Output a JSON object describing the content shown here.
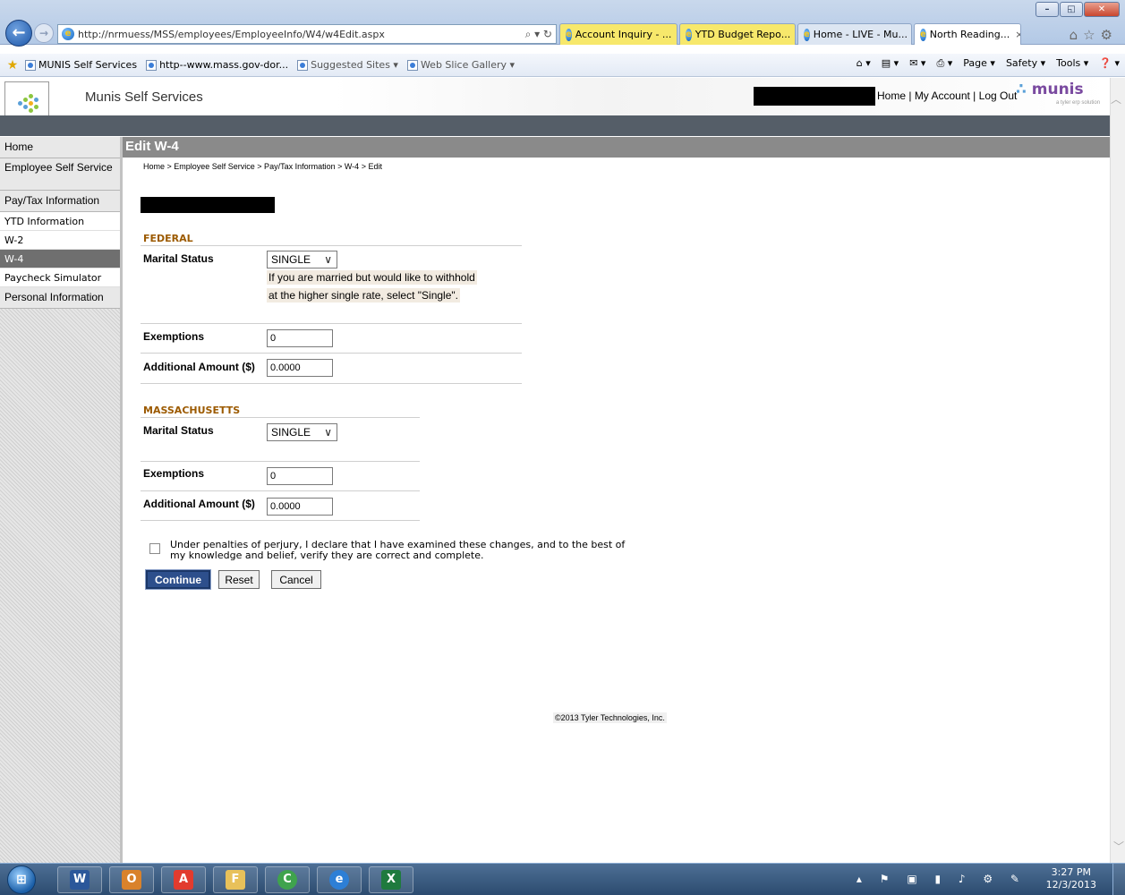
{
  "browser": {
    "url": "http://nrmuess/MSS/employees/EmployeeInfo/W4/w4Edit.aspx",
    "address_icons": "⌕ ▾ ↻",
    "tabs": [
      {
        "title": "Account Inquiry - ...",
        "style": "yellow"
      },
      {
        "title": "YTD Budget Repo...",
        "style": "yellow"
      },
      {
        "title": "Home - LIVE - Mu...",
        "style": "gray"
      },
      {
        "title": "North Reading...",
        "style": "active"
      }
    ],
    "tab_close": "×",
    "favorites": [
      {
        "label": "MUNIS Self Services"
      },
      {
        "label": "http--www.mass.gov-dor..."
      },
      {
        "label": "Suggested Sites ▾"
      },
      {
        "label": "Web Slice Gallery ▾"
      }
    ],
    "commands": [
      "⌂ ▾",
      "▤ ▾",
      "✉ ▾",
      "⎙ ▾",
      "Page ▾",
      "Safety ▾",
      "Tools ▾",
      "❓ ▾"
    ],
    "window_buttons": [
      "–",
      "◱",
      "✕"
    ]
  },
  "app": {
    "title": "Munis Self Services",
    "links": {
      "home": "Home",
      "sep1": " | ",
      "account": "My Account",
      "sep2": " | ",
      "logout": "Log Out"
    },
    "brand": "munis",
    "brand_sub": "a tyler erp solution",
    "page_title": "Edit W-4",
    "breadcrumb": "Home > Employee Self Service > Pay/Tax Information > W-4 > Edit"
  },
  "sidebar": {
    "items": [
      {
        "label": "Home"
      },
      {
        "label": "Employee Self Service"
      },
      {
        "label": "Pay/Tax Information"
      }
    ],
    "subitems": [
      {
        "label": "YTD Information"
      },
      {
        "label": "W-2"
      },
      {
        "label": "W-4"
      },
      {
        "label": "Paycheck Simulator"
      }
    ],
    "personal": "Personal Information"
  },
  "form": {
    "federal": {
      "heading": "FEDERAL",
      "marital_label": "Marital Status",
      "marital_value": "SINGLE",
      "hint_line1": "If you are married but would like to withhold",
      "hint_line2": "at the higher single rate, select \"Single\".",
      "exemptions_label": "Exemptions",
      "exemptions_value": "0",
      "additional_label": "Additional Amount ($)",
      "additional_value": "0.0000"
    },
    "state": {
      "heading": "MASSACHUSETTS",
      "marital_label": "Marital Status",
      "marital_value": "SINGLE",
      "exemptions_label": "Exemptions",
      "exemptions_value": "0",
      "additional_label": "Additional Amount ($)",
      "additional_value": "0.0000"
    },
    "perjury_text": "Under penalties of perjury, I declare that I have examined these changes, and to the best of my knowledge and belief, verify they are correct and complete.",
    "perjury_checked": false,
    "buttons": {
      "continue": "Continue",
      "reset": "Reset",
      "cancel": "Cancel"
    }
  },
  "footer": {
    "copyright": "©2013 Tyler Technologies, Inc."
  },
  "taskbar": {
    "apps": [
      {
        "name": "W",
        "color": "#2b579a"
      },
      {
        "name": "O",
        "color": "#d9822b"
      },
      {
        "name": "A",
        "color": "#e23b2e"
      },
      {
        "name": "F",
        "color": "#e8c15a"
      },
      {
        "name": "C",
        "color": "#3fa34d"
      },
      {
        "name": "e",
        "color": "#2d7fd6"
      },
      {
        "name": "X",
        "color": "#1f7a3e"
      }
    ],
    "tray_icons": "▴ ⚑ ▣ ▮ ♪ ⚙ ✎",
    "time": "3:27 PM",
    "date": "12/3/2013"
  }
}
